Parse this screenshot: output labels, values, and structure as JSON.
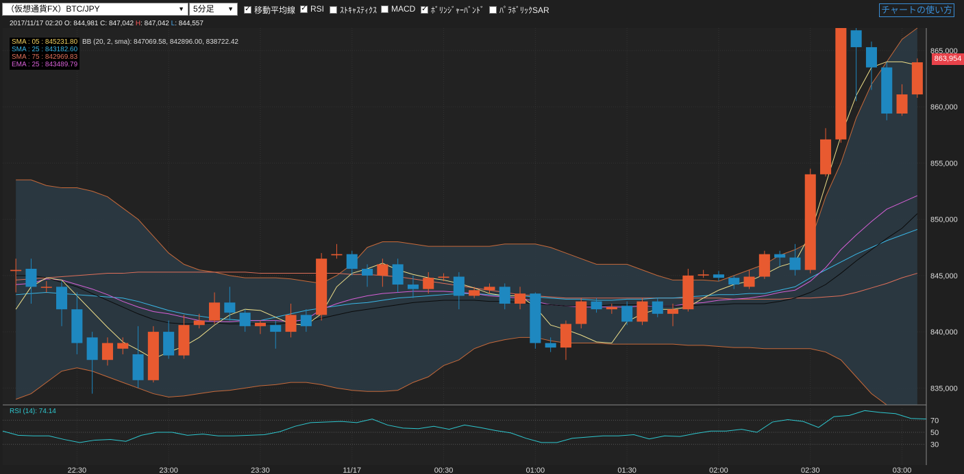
{
  "toolbar": {
    "symbol": "（仮想通貨FX）BTC/JPY",
    "interval": "5分足",
    "options": [
      {
        "label": "移動平均線",
        "checked": true
      },
      {
        "label": "RSI",
        "checked": true
      },
      {
        "label": "ｽﾄｷｬｽﾃｨｸｽ",
        "checked": false
      },
      {
        "label": "MACD",
        "checked": false
      },
      {
        "label": "ﾎﾞﾘﾝｼﾞｬｰﾊﾞﾝﾄﾞ",
        "checked": true
      },
      {
        "label": "ﾊﾟﾗﾎﾞﾘｯｸSAR",
        "checked": false
      }
    ],
    "help_link": "チャートの使い方"
  },
  "ohlc": {
    "datetime": "2017/11/17 02:20",
    "o_label": "O:",
    "o": "844,981",
    "c_label": "C:",
    "c": "847,042",
    "h_label": "H",
    "h": ": 847,042",
    "l_label": "L",
    "l": ": 844,557"
  },
  "legend": [
    {
      "text": "SMA : 05 : 845231.80",
      "color": "#f0d060"
    },
    {
      "text": "SMA : 25 : 843182.60",
      "color": "#3ab8e8"
    },
    {
      "text": "SMA : 75 : 842969.83",
      "color": "#e0705a"
    },
    {
      "text": "EMA : 25 : 843489.79",
      "color": "#d860d8"
    }
  ],
  "bb_text": "BB (20, 2, sma): 847069.58, 842896.00, 838722.42",
  "rsi_label": "RSI (14): 74.14",
  "current_price": "863,954",
  "colors": {
    "up": "#e85a30",
    "down": "#1e88c0",
    "band": "#2b3a44",
    "bg": "#222222"
  },
  "chart_data": {
    "type": "candlestick",
    "ylim": [
      833500,
      867000
    ],
    "yticks": [
      "835,000",
      "840,000",
      "845,000",
      "850,000",
      "855,000",
      "860,000",
      "865,000"
    ],
    "ytick_values": [
      835000,
      840000,
      845000,
      850000,
      855000,
      860000,
      865000
    ],
    "xticks": [
      "22:30",
      "23:00",
      "23:30",
      "11/17",
      "00:30",
      "01:00",
      "01:30",
      "02:00",
      "02:30",
      "03:00"
    ],
    "xtick_index": [
      4,
      10,
      16,
      22,
      28,
      34,
      40,
      46,
      52,
      58
    ],
    "candles": [
      {
        "o": 845400,
        "c": 845500,
        "h": 846500,
        "l": 843500
      },
      {
        "o": 845600,
        "c": 844000,
        "h": 846500,
        "l": 842500
      },
      {
        "o": 844000,
        "c": 844000,
        "h": 844500,
        "l": 843500
      },
      {
        "o": 844000,
        "c": 842000,
        "h": 844500,
        "l": 840500
      },
      {
        "o": 842000,
        "c": 839000,
        "h": 843500,
        "l": 838000
      },
      {
        "o": 839500,
        "c": 837500,
        "h": 840000,
        "l": 834500
      },
      {
        "o": 837500,
        "c": 839000,
        "h": 839500,
        "l": 837000
      },
      {
        "o": 838500,
        "c": 839000,
        "h": 839500,
        "l": 838000
      },
      {
        "o": 838000,
        "c": 835700,
        "h": 840500,
        "l": 835000
      },
      {
        "o": 835700,
        "c": 840000,
        "h": 840500,
        "l": 835500
      },
      {
        "o": 840000,
        "c": 837900,
        "h": 841000,
        "l": 837600
      },
      {
        "o": 837900,
        "c": 840600,
        "h": 841500,
        "l": 837600
      },
      {
        "o": 840600,
        "c": 841000,
        "h": 841600,
        "l": 840300
      },
      {
        "o": 841000,
        "c": 842600,
        "h": 843500,
        "l": 840700
      },
      {
        "o": 842600,
        "c": 841700,
        "h": 844000,
        "l": 841000
      },
      {
        "o": 841700,
        "c": 840500,
        "h": 842000,
        "l": 840000
      },
      {
        "o": 840500,
        "c": 840800,
        "h": 841000,
        "l": 839800
      },
      {
        "o": 840600,
        "c": 840000,
        "h": 841000,
        "l": 838500
      },
      {
        "o": 840000,
        "c": 841500,
        "h": 842500,
        "l": 839500
      },
      {
        "o": 841500,
        "c": 840500,
        "h": 842000,
        "l": 840000
      },
      {
        "o": 841500,
        "c": 846500,
        "h": 847000,
        "l": 841000
      },
      {
        "o": 846800,
        "c": 846900,
        "h": 847800,
        "l": 846500
      },
      {
        "o": 846900,
        "c": 845600,
        "h": 847200,
        "l": 845000
      },
      {
        "o": 845600,
        "c": 845000,
        "h": 846000,
        "l": 844000
      },
      {
        "o": 845000,
        "c": 846000,
        "h": 846500,
        "l": 844000
      },
      {
        "o": 846000,
        "c": 844200,
        "h": 846500,
        "l": 843500
      },
      {
        "o": 844200,
        "c": 843800,
        "h": 845000,
        "l": 843000
      },
      {
        "o": 843800,
        "c": 844800,
        "h": 845300,
        "l": 843400
      },
      {
        "o": 844800,
        "c": 844900,
        "h": 845200,
        "l": 844500
      },
      {
        "o": 844900,
        "c": 843200,
        "h": 845300,
        "l": 842000
      },
      {
        "o": 843200,
        "c": 843700,
        "h": 844000,
        "l": 843000
      },
      {
        "o": 843700,
        "c": 844000,
        "h": 844300,
        "l": 843400
      },
      {
        "o": 844000,
        "c": 842500,
        "h": 844300,
        "l": 842000
      },
      {
        "o": 842500,
        "c": 843400,
        "h": 844000,
        "l": 842000
      },
      {
        "o": 843400,
        "c": 839000,
        "h": 843500,
        "l": 838500
      },
      {
        "o": 839000,
        "c": 838600,
        "h": 839500,
        "l": 838200
      },
      {
        "o": 838600,
        "c": 840700,
        "h": 841000,
        "l": 837500
      },
      {
        "o": 840700,
        "c": 842700,
        "h": 843000,
        "l": 840300
      },
      {
        "o": 842700,
        "c": 842000,
        "h": 843000,
        "l": 841700
      },
      {
        "o": 842000,
        "c": 842200,
        "h": 842500,
        "l": 841600
      },
      {
        "o": 842300,
        "c": 840900,
        "h": 842700,
        "l": 840600
      },
      {
        "o": 840900,
        "c": 842700,
        "h": 843000,
        "l": 840600
      },
      {
        "o": 842700,
        "c": 841600,
        "h": 843000,
        "l": 841300
      },
      {
        "o": 841600,
        "c": 842000,
        "h": 842500,
        "l": 840500
      },
      {
        "o": 842000,
        "c": 845000,
        "h": 845600,
        "l": 841800
      },
      {
        "o": 845000,
        "c": 845100,
        "h": 845500,
        "l": 844800
      },
      {
        "o": 845100,
        "c": 844800,
        "h": 845400,
        "l": 844500
      },
      {
        "o": 844800,
        "c": 844200,
        "h": 845000,
        "l": 843800
      },
      {
        "o": 844000,
        "c": 844900,
        "h": 845500,
        "l": 843800
      },
      {
        "o": 844900,
        "c": 846900,
        "h": 847200,
        "l": 844700
      },
      {
        "o": 846900,
        "c": 846600,
        "h": 847200,
        "l": 845800
      },
      {
        "o": 846600,
        "c": 845500,
        "h": 847800,
        "l": 845000
      },
      {
        "o": 845500,
        "c": 854000,
        "h": 854500,
        "l": 845200
      },
      {
        "o": 854000,
        "c": 857100,
        "h": 858100,
        "l": 853800
      },
      {
        "o": 857100,
        "c": 867000,
        "h": 867000,
        "l": 856800
      },
      {
        "o": 866800,
        "c": 865300,
        "h": 867000,
        "l": 860500
      },
      {
        "o": 865300,
        "c": 863500,
        "h": 865800,
        "l": 861500
      },
      {
        "o": 863500,
        "c": 859400,
        "h": 864000,
        "l": 858800
      },
      {
        "o": 859400,
        "c": 861100,
        "h": 862000,
        "l": 859200
      },
      {
        "o": 861100,
        "c": 863954,
        "h": 864300,
        "l": 860800
      }
    ],
    "sma5": [
      842000,
      844000,
      844800,
      844600,
      843200,
      841800,
      840400,
      839100,
      838400,
      837600,
      838200,
      838700,
      839500,
      840600,
      841500,
      842000,
      841900,
      841300,
      840700,
      840600,
      841600,
      844000,
      845200,
      845600,
      846100,
      845500,
      845100,
      844800,
      844600,
      844300,
      843900,
      843400,
      843200,
      843200,
      842200,
      840600,
      840200,
      839700,
      839100,
      839000,
      840900,
      841600,
      842000,
      842000,
      842200,
      843000,
      843700,
      844200,
      844500,
      845100,
      845800,
      846200,
      848700,
      853100,
      857400,
      861000,
      863500,
      864000,
      864000,
      863700
    ],
    "ema25": [
      844200,
      844300,
      844700,
      844600,
      844200,
      843800,
      843300,
      842700,
      842200,
      841800,
      841600,
      841300,
      841000,
      840900,
      840900,
      841000,
      841000,
      841000,
      840900,
      841100,
      842000,
      842500,
      842900,
      843200,
      843400,
      843500,
      843600,
      843600,
      843600,
      843500,
      843400,
      843200,
      843100,
      843000,
      842700,
      842400,
      842300,
      842200,
      842200,
      842200,
      842200,
      842300,
      842300,
      842300,
      842500,
      842600,
      842800,
      842900,
      843000,
      843200,
      843500,
      843700,
      844500,
      845700,
      847300,
      848600,
      849800,
      850900,
      851500,
      852100
    ],
    "sma25": [
      843300,
      843400,
      843500,
      843400,
      843300,
      843200,
      843100,
      843000,
      842700,
      842300,
      841900,
      841600,
      841400,
      841200,
      841100,
      841000,
      841000,
      841300,
      841600,
      841900,
      842100,
      842300,
      842500,
      842600,
      842800,
      843000,
      843100,
      843200,
      843300,
      843400,
      843400,
      843300,
      843200,
      843200,
      843100,
      843000,
      842900,
      842900,
      842800,
      842800,
      842900,
      842900,
      843000,
      843000,
      843100,
      843200,
      843300,
      843300,
      843400,
      843400,
      843700,
      844000,
      844800,
      845500,
      846200,
      846900,
      847500,
      848100,
      848600,
      849100
    ],
    "sma75": [
      844600,
      844700,
      844800,
      844900,
      845000,
      845100,
      845200,
      845200,
      845300,
      845300,
      845300,
      845300,
      845300,
      845300,
      845300,
      845300,
      845200,
      845200,
      845200,
      845200,
      845200,
      845200,
      845100,
      845100,
      845000,
      844900,
      844700,
      844500,
      844300,
      844100,
      843900,
      843700,
      843500,
      843300,
      843200,
      843100,
      843000,
      843000,
      843000,
      843000,
      843000,
      843000,
      843000,
      843000,
      843000,
      843000,
      843000,
      842900,
      842900,
      842900,
      842900,
      843000,
      843000,
      843100,
      843200,
      843500,
      843900,
      844300,
      844800,
      845200
    ],
    "black": [
      845000,
      845000,
      844800,
      844400,
      844000,
      843400,
      842800,
      842200,
      841600,
      841100,
      840800,
      840700,
      840700,
      840800,
      840700,
      840700,
      840700,
      840700,
      840800,
      840900,
      841200,
      841500,
      841800,
      842000,
      842200,
      842400,
      842600,
      842700,
      842800,
      842800,
      842800,
      842700,
      842700,
      842600,
      842500,
      842400,
      842300,
      842300,
      842300,
      842400,
      842400,
      842400,
      842300,
      842300,
      842300,
      842400,
      842400,
      842500,
      842500,
      842500,
      842700,
      843000,
      843500,
      844200,
      845200,
      846300,
      847300,
      848300,
      849200,
      850500
    ],
    "bb_upper": [
      853500,
      853500,
      853000,
      852800,
      852800,
      852500,
      852000,
      851000,
      850000,
      848500,
      847000,
      846000,
      845500,
      845300,
      845000,
      844800,
      844800,
      844800,
      844700,
      844500,
      844300,
      845000,
      846000,
      847500,
      848000,
      848000,
      847800,
      847600,
      847600,
      847600,
      847600,
      847600,
      847800,
      847800,
      847800,
      847500,
      847000,
      846500,
      846000,
      846000,
      846000,
      845500,
      845000,
      844600,
      844600,
      844600,
      844500,
      845000,
      845500,
      846000,
      846800,
      847300,
      848000,
      852000,
      855000,
      859000,
      862000,
      864000,
      866000,
      867000
    ],
    "bb_lower": [
      834000,
      834500,
      835500,
      836500,
      836800,
      836500,
      836000,
      835500,
      835000,
      834500,
      834200,
      834300,
      834500,
      834700,
      834800,
      835000,
      835200,
      835300,
      835500,
      835500,
      835300,
      835000,
      834800,
      834700,
      834700,
      834800,
      835500,
      836000,
      837000,
      837500,
      838500,
      839000,
      839300,
      839500,
      839500,
      839200,
      839000,
      839000,
      839000,
      838900,
      838900,
      838900,
      838900,
      838900,
      838800,
      838800,
      838700,
      838600,
      838600,
      838500,
      838500,
      838500,
      838500,
      838200,
      837500,
      836000,
      834500,
      833500,
      833500,
      833500
    ],
    "rsi_yticks": [
      "70",
      "50",
      "30"
    ],
    "rsi": [
      52,
      45,
      44,
      44,
      38,
      33,
      37,
      38,
      35,
      45,
      50,
      50,
      45,
      47,
      44,
      44,
      45,
      46,
      51,
      60,
      66,
      67,
      68,
      66,
      72,
      62,
      57,
      56,
      60,
      55,
      62,
      58,
      53,
      49,
      40,
      33,
      33,
      40,
      42,
      44,
      44,
      46,
      39,
      44,
      43,
      48,
      52,
      52,
      55,
      50,
      67,
      71,
      68,
      58,
      76,
      78,
      86,
      83,
      81,
      73,
      72
    ]
  },
  "xtick_labels": [
    "22:30",
    "23:00",
    "23:30",
    "11/17",
    "00:30",
    "01:00",
    "01:30",
    "02:00",
    "02:30",
    "03:00"
  ]
}
